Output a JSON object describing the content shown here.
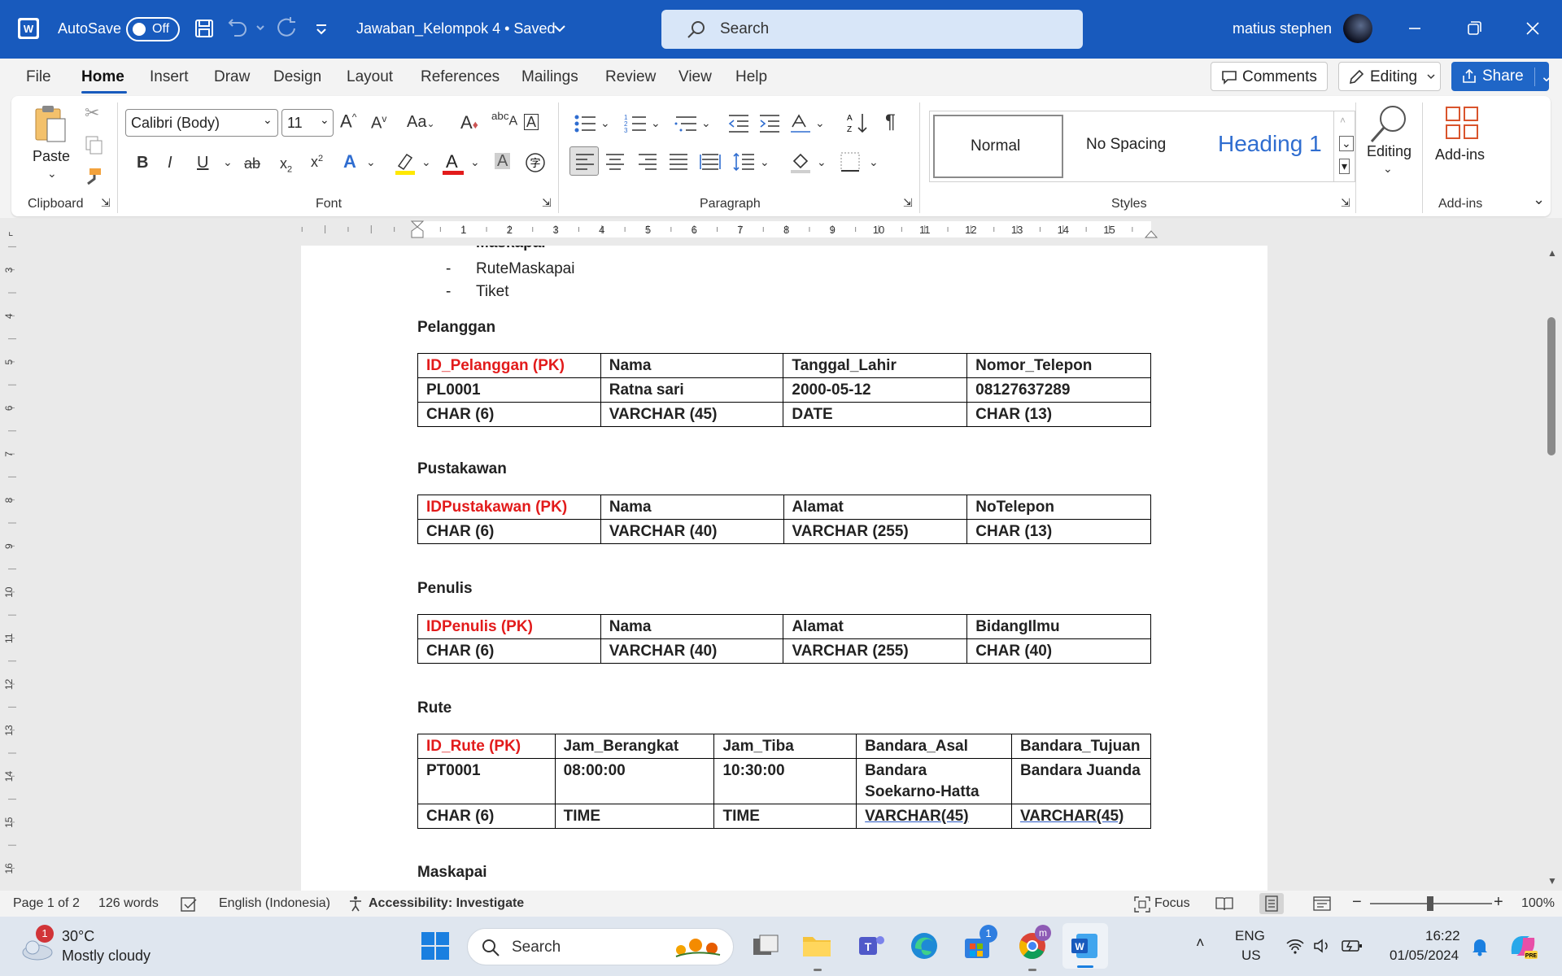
{
  "titlebar": {
    "autosave_label": "AutoSave",
    "autosave_state": "Off",
    "document_title": "Jawaban_Kelompok 4 • Saved",
    "search_placeholder": "Search",
    "user_name": "matius stephen"
  },
  "menu": {
    "tabs": [
      "File",
      "Home",
      "Insert",
      "Draw",
      "Design",
      "Layout",
      "References",
      "Mailings",
      "Review",
      "View",
      "Help"
    ],
    "active_tab": "Home",
    "comments_label": "Comments",
    "editing_label": "Editing",
    "share_label": "Share"
  },
  "ribbon": {
    "paste_label": "Paste",
    "font_name": "Calibri (Body)",
    "font_size": "11",
    "styles": [
      "Normal",
      "No Spacing",
      "Heading 1"
    ],
    "editing_label": "Editing",
    "addins_label": "Add-ins",
    "groups": {
      "clipboard": "Clipboard",
      "font": "Font",
      "paragraph": "Paragraph",
      "styles": "Styles",
      "addins": "Add-ins"
    }
  },
  "ruler": {
    "marks": [
      "1",
      "2",
      "3",
      "4",
      "5",
      "6",
      "7",
      "8",
      "9",
      "10",
      "11",
      "12",
      "13",
      "14",
      "15"
    ],
    "vmarks": [
      "3",
      "4",
      "5",
      "6",
      "7",
      "8",
      "9",
      "10",
      "11",
      "12",
      "13",
      "14",
      "15",
      "16"
    ]
  },
  "document": {
    "bullets": [
      "Maskapai",
      "RuteMaskapai",
      "Tiket"
    ],
    "sections": {
      "pelanggan": {
        "title": "Pelanggan",
        "rows": [
          [
            "ID_Pelanggan (PK)",
            "Nama",
            "Tanggal_Lahir",
            "Nomor_Telepon"
          ],
          [
            "PL0001",
            "Ratna sari",
            "2000-05-12",
            "08127637289"
          ],
          [
            "CHAR (6)",
            "VARCHAR (45)",
            "DATE",
            "CHAR (13)"
          ]
        ]
      },
      "pustakawan": {
        "title": "Pustakawan",
        "rows": [
          [
            "IDPustakawan (PK)",
            "Nama",
            "Alamat",
            "NoTelepon"
          ],
          [
            "CHAR (6)",
            "VARCHAR (40)",
            "VARCHAR (255)",
            "CHAR (13)"
          ]
        ]
      },
      "penulis": {
        "title": "Penulis",
        "rows": [
          [
            "IDPenulis (PK)",
            "Nama",
            "Alamat",
            "BidangIlmu"
          ],
          [
            "CHAR (6)",
            "VARCHAR (40)",
            "VARCHAR (255)",
            "CHAR (40)"
          ]
        ]
      },
      "rute": {
        "title": "Rute",
        "rows": [
          [
            "ID_Rute (PK)",
            "Jam_Berangkat",
            "Jam_Tiba",
            "Bandara_Asal",
            "Bandara_Tujuan"
          ],
          [
            "PT0001",
            "08:00:00",
            "10:30:00",
            "Bandara Soekarno-Hatta",
            "Bandara Juanda"
          ],
          [
            "CHAR (6)",
            "TIME",
            "TIME",
            "VARCHAR(45)",
            "VARCHAR(45)"
          ]
        ]
      },
      "maskapai": {
        "title": "Maskapai"
      }
    }
  },
  "statusbar": {
    "page": "Page 1 of 2",
    "words": "126 words",
    "language": "English (Indonesia)",
    "accessibility": "Accessibility: Investigate",
    "focus": "Focus",
    "zoom": "100%"
  },
  "taskbar": {
    "weather_temp": "30°C",
    "weather_desc": "Mostly cloudy",
    "weather_badge": "1",
    "search_label": "Search",
    "lang_top": "ENG",
    "lang_bottom": "US",
    "time": "16:22",
    "date": "01/05/2024",
    "store_badge": "1"
  },
  "colors": {
    "titlebar": "#185abd",
    "pk_text": "#e21b1b",
    "accent": "#185abd"
  }
}
